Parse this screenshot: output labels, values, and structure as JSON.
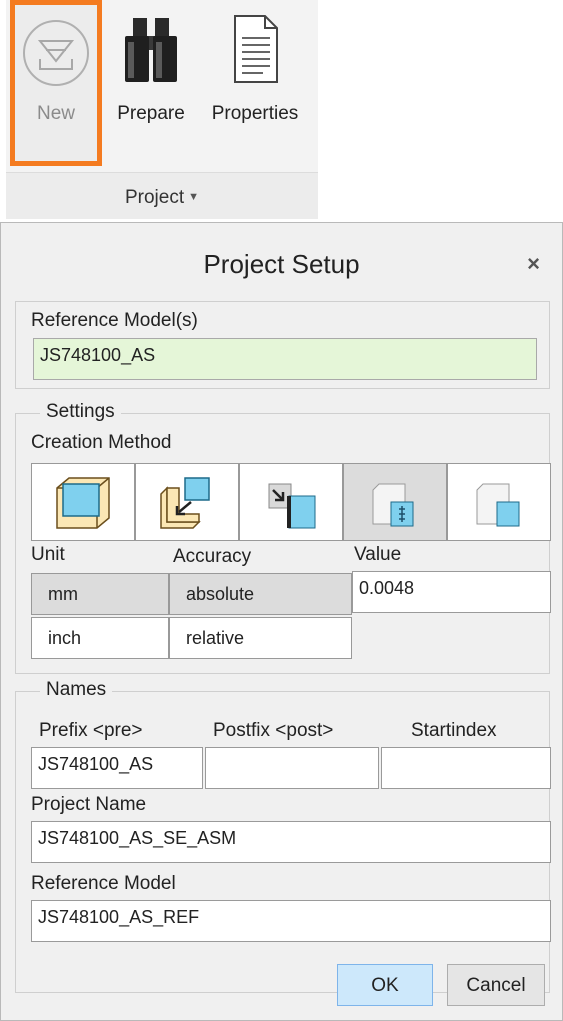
{
  "ribbon": {
    "buttons": {
      "new": "New",
      "prepare": "Prepare",
      "properties": "Properties"
    },
    "group_label": "Project"
  },
  "dialog": {
    "title": "Project Setup",
    "close": "×",
    "reference_models": {
      "label": "Reference Model(s)",
      "value": "JS748100_AS"
    },
    "settings": {
      "legend": "Settings",
      "creation_method_label": "Creation Method",
      "unit_label": "Unit",
      "accuracy_label": "Accuracy",
      "value_label": "Value",
      "units": [
        "mm",
        "inch"
      ],
      "accuracies": [
        "absolute",
        "relative"
      ],
      "value": "0.0048"
    },
    "names": {
      "legend": "Names",
      "prefix_label": "Prefix <pre>",
      "postfix_label": "Postfix <post>",
      "startindex_label": "Startindex",
      "prefix_value": "JS748100_AS",
      "postfix_value": "",
      "startindex_value": "",
      "project_name_label": "Project Name",
      "project_name_value": "JS748100_AS_SE_ASM",
      "reference_model_label": "Reference Model",
      "reference_model_value": "JS748100_AS_REF"
    },
    "buttons": {
      "ok": "OK",
      "cancel": "Cancel"
    }
  },
  "colors": {
    "highlight_orange": "#f47b20",
    "input_green": "#e5f6d8",
    "ok_blue": "#cde8fb",
    "cube_blue": "#7fd0ee",
    "cube_orange": "#fbe7b5"
  }
}
